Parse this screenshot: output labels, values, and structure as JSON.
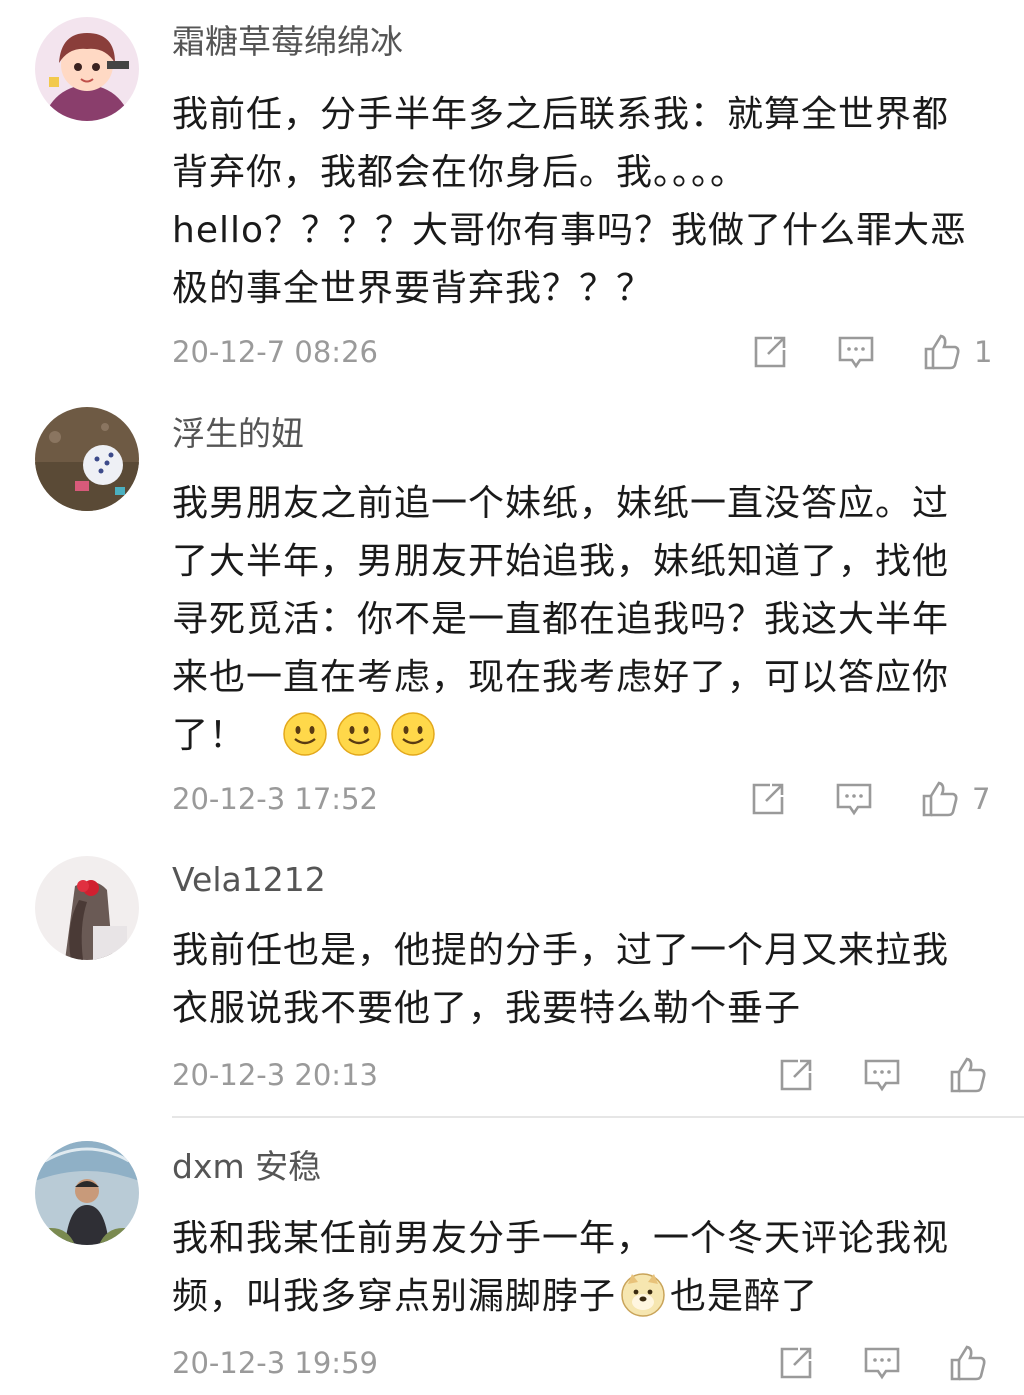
{
  "comments": [
    {
      "username": "霜糖草莓绵绵冰",
      "lines": [
        "我前任，分手半年多之后联系我：就算全世界都",
        "背弃你，我都会在你身后。我。。。。",
        "hello？？？？大哥你有事吗？我做了什么罪大恶",
        "极的事全世界要背弃我？？？"
      ],
      "timestamp": "20-12-7 08:26",
      "likes": "1"
    },
    {
      "username": "浮生的妞",
      "lines": [
        "我男朋友之前追一个妹纸，妹纸一直没答应。过",
        "了大半年，男朋友开始追我，妹纸知道了，找他",
        "寻死觅活：你不是一直都在追我吗？我这大半年",
        "来也一直在考虑，现在我考虑好了，可以答应你",
        "了！"
      ],
      "timestamp": "20-12-3 17:52",
      "likes": "7"
    },
    {
      "username": "Vela1212",
      "lines": [
        "我前任也是，他提的分手，过了一个月又来拉我",
        "衣服说我不要他了，我要特么勒个垂子"
      ],
      "timestamp": "20-12-3 20:13",
      "likes": ""
    },
    {
      "username": "dxm 安稳",
      "lines": [
        "我和我某任前男友分手一年，一个冬天评论我视",
        "频，叫我多穿点别漏脚脖子",
        "也是醉了"
      ],
      "timestamp": "20-12-3 19:59",
      "likes": ""
    }
  ],
  "icons": {
    "share": "share-icon",
    "reply": "comment-icon",
    "like": "thumbs-up-icon",
    "smile_emoji": "smile-emoji-icon",
    "doge_emoji": "doge-emoji-icon"
  },
  "colors": {
    "text": "#1a1a1a",
    "username": "#555555",
    "meta": "#9a9a9a",
    "divider": "#e6e6e6"
  }
}
